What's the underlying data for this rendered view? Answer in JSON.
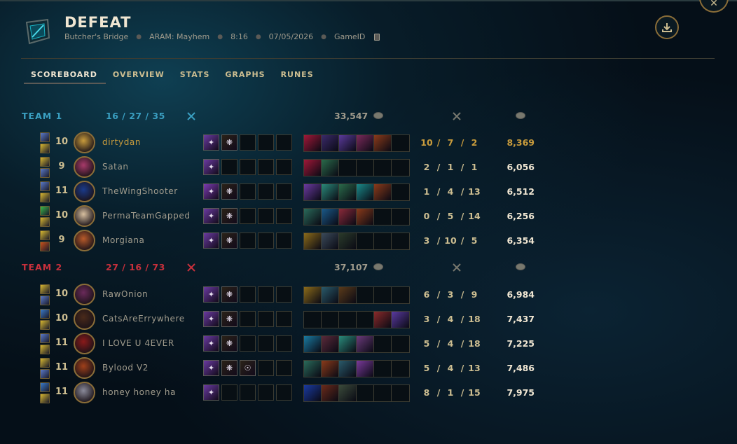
{
  "header": {
    "result": "DEFEAT",
    "map": "Butcher's Bridge",
    "mode": "ARAM: Mayhem",
    "duration": "8:16",
    "date": "07/05/2026",
    "game_id_label": "GameID",
    "result_icon": "defeat-crest-icon",
    "download_icon": "download-icon",
    "close_icon": "close-icon"
  },
  "tabs": [
    {
      "label": "SCOREBOARD",
      "active": true
    },
    {
      "label": "OVERVIEW",
      "active": false
    },
    {
      "label": "STATS",
      "active": false
    },
    {
      "label": "GRAPHS",
      "active": false
    },
    {
      "label": "RUNES",
      "active": false
    }
  ],
  "colors": {
    "team1": "#3a9fc1",
    "team2": "#c8303c",
    "gold": "#c89b3c",
    "text": "#cdbe91"
  },
  "teams": [
    {
      "name": "TEAM 1",
      "kills": "16",
      "deaths": "27",
      "assists": "35",
      "total_gold": "33,547",
      "players": [
        {
          "level": "10",
          "name": "dirtydan",
          "kills": "10",
          "deaths": "7",
          "assists": "2",
          "gold": "8,369",
          "me": true,
          "spell_colors": [
            "#5a7ac8",
            "#d8b830"
          ],
          "avatar_color": "#c89b3c",
          "augments": [
            "#6a3aa0",
            "#2a2218"
          ],
          "item_colors": [
            "#a01838",
            "#3a2a6a",
            "#5a3a9a",
            "#7a2a5a",
            "#8a3a1a"
          ]
        },
        {
          "level": "9",
          "name": "Satan",
          "kills": "2",
          "deaths": "1",
          "assists": "1",
          "gold": "6,056",
          "me": false,
          "spell_colors": [
            "#d8b830",
            "#5a7ac8"
          ],
          "avatar_color": "#a83a6a",
          "augments": [
            "#6a3aa0"
          ],
          "item_colors": [
            "#a01838",
            "#2a6a4a"
          ]
        },
        {
          "level": "11",
          "name": "TheWingShooter",
          "kills": "1",
          "deaths": "4",
          "assists": "13",
          "gold": "6,512",
          "me": false,
          "spell_colors": [
            "#5a7ac8",
            "#d8b830"
          ],
          "avatar_color": "#1a3a8a",
          "augments": [
            "#7a3ab0",
            "#2a2218"
          ],
          "item_colors": [
            "#6a3aa0",
            "#2a8a7a",
            "#2a6a4a",
            "#1a8a8a",
            "#8a3a1a"
          ]
        },
        {
          "level": "10",
          "name": "PermaTeamGapped",
          "kills": "0",
          "deaths": "5",
          "assists": "14",
          "gold": "6,256",
          "me": false,
          "spell_colors": [
            "#3ab84a",
            "#d8b830"
          ],
          "avatar_color": "#d8c0a0",
          "augments": [
            "#6a3aa0",
            "#2a2218"
          ],
          "item_colors": [
            "#2a6a5a",
            "#1a5a8a",
            "#8a2a3a",
            "#8a3a1a"
          ]
        },
        {
          "level": "9",
          "name": "Morgiana",
          "kills": "3",
          "deaths": "10",
          "assists": "5",
          "gold": "6,354",
          "me": false,
          "spell_colors": [
            "#d8b830",
            "#c8501a"
          ],
          "avatar_color": "#b85a2a",
          "augments": [
            "#6a3aa0",
            "#2a2218"
          ],
          "item_colors": [
            "#8a6a1a",
            "#3a4a5a",
            "#2a3a2a"
          ]
        }
      ]
    },
    {
      "name": "TEAM 2",
      "kills": "27",
      "deaths": "16",
      "assists": "73",
      "total_gold": "37,107",
      "players": [
        {
          "level": "10",
          "name": "RawOnion",
          "kills": "6",
          "deaths": "3",
          "assists": "9",
          "gold": "6,984",
          "me": false,
          "spell_colors": [
            "#d8b830",
            "#5a7ac8"
          ],
          "avatar_color": "#6a2a5a",
          "augments": [
            "#6a3aa0",
            "#2a2218"
          ],
          "item_colors": [
            "#8a6a1a",
            "#2a5a6a",
            "#5a3a1a"
          ]
        },
        {
          "level": "10",
          "name": "CatsAreErrywhere",
          "kills": "3",
          "deaths": "4",
          "assists": "18",
          "gold": "7,437",
          "me": false,
          "spell_colors": [
            "#3a7ac8",
            "#d8b830"
          ],
          "avatar_color": "#4a2a1a",
          "augments": [
            "#6a3aa0",
            "#2a2218"
          ],
          "item_colors": [
            "",
            "",
            "",
            "",
            "#8a2a2a",
            "#5a3aa0"
          ]
        },
        {
          "level": "11",
          "name": "I LOVE U 4EVER",
          "kills": "5",
          "deaths": "4",
          "assists": "18",
          "gold": "7,225",
          "me": false,
          "spell_colors": [
            "#5a7ac8",
            "#d8b830"
          ],
          "avatar_color": "#8a1a1a",
          "augments": [
            "#6a3aa0",
            "#2a2218"
          ],
          "item_colors": [
            "#1a7aa0",
            "#5a2a3a",
            "#2a8a7a",
            "#6a3a7a"
          ]
        },
        {
          "level": "11",
          "name": "Bylood V2",
          "kills": "5",
          "deaths": "4",
          "assists": "13",
          "gold": "7,486",
          "me": false,
          "spell_colors": [
            "#d8b830",
            "#5a7ac8"
          ],
          "avatar_color": "#a0401a",
          "augments": [
            "#6a3aa0",
            "#2a2218",
            "#2a2218"
          ],
          "item_colors": [
            "#2a6a5a",
            "#8a3a1a",
            "#2a5a6a",
            "#7a3a9a"
          ]
        },
        {
          "level": "11",
          "name": "honey honey ha",
          "kills": "8",
          "deaths": "1",
          "assists": "15",
          "gold": "7,975",
          "me": false,
          "spell_colors": [
            "#3a7ac8",
            "#d8b830"
          ],
          "avatar_color": "#8a8a9a",
          "augments": [
            "#6a3aa0"
          ],
          "item_colors": [
            "#1a3aa0",
            "#6a2a1a",
            "#3a4a3a"
          ]
        }
      ]
    }
  ]
}
